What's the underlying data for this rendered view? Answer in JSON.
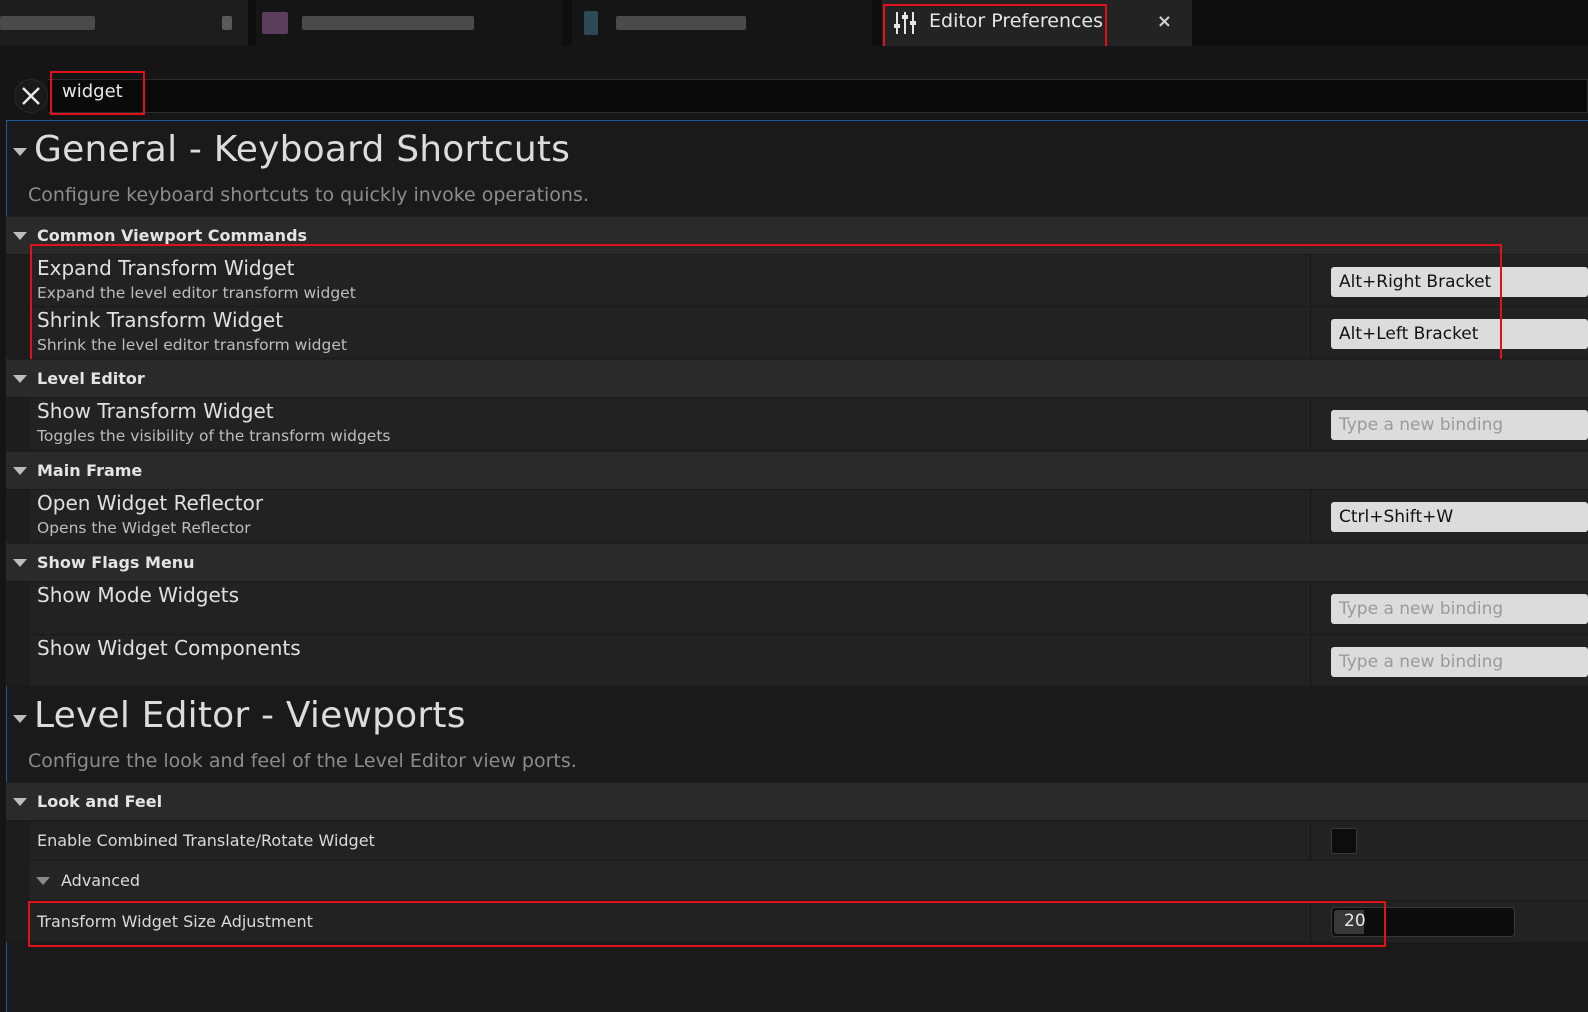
{
  "tabs": [
    {
      "label": "",
      "blurred": true
    },
    {
      "label": "",
      "blurred": true
    },
    {
      "label": "",
      "blurred": true
    },
    {
      "label": "Editor Preferences",
      "icon": "sliders-icon",
      "close": "×"
    }
  ],
  "search": {
    "value": "widget",
    "clear_icon": "close-icon"
  },
  "sections": [
    {
      "title": "General - Keyboard Shortcuts",
      "description": "Configure keyboard shortcuts to quickly invoke operations."
    },
    {
      "title": "Level Editor - Viewports",
      "description": "Configure the look and feel of the Level Editor view ports."
    }
  ],
  "categories": {
    "common_viewport": "Common Viewport Commands",
    "level_editor": "Level Editor",
    "main_frame": "Main Frame",
    "show_flags": "Show Flags Menu",
    "look_and_feel": "Look and Feel",
    "advanced": "Advanced"
  },
  "rows": {
    "expand": {
      "name": "Expand Transform Widget",
      "desc": "Expand the level editor transform widget",
      "binding": "Alt+Right Bracket"
    },
    "shrink": {
      "name": "Shrink Transform Widget",
      "desc": "Shrink the level editor transform widget",
      "binding": "Alt+Left Bracket"
    },
    "show_transform": {
      "name": "Show Transform Widget",
      "desc": "Toggles the visibility of the transform widgets",
      "binding": "Type a new binding"
    },
    "open_reflector": {
      "name": "Open Widget Reflector",
      "desc": "Opens the Widget Reflector",
      "binding": "Ctrl+Shift+W"
    },
    "show_mode": {
      "name": "Show Mode Widgets",
      "binding": "Type a new binding"
    },
    "show_components": {
      "name": "Show Widget Components",
      "binding": "Type a new binding"
    },
    "combined": {
      "name": "Enable Combined Translate/Rotate Widget",
      "checked": false
    },
    "size_adjust": {
      "name": "Transform Widget Size Adjustment",
      "value": "20"
    }
  },
  "colors": {
    "highlight": "#e0111a",
    "accent_border": "#1e5a9a"
  }
}
